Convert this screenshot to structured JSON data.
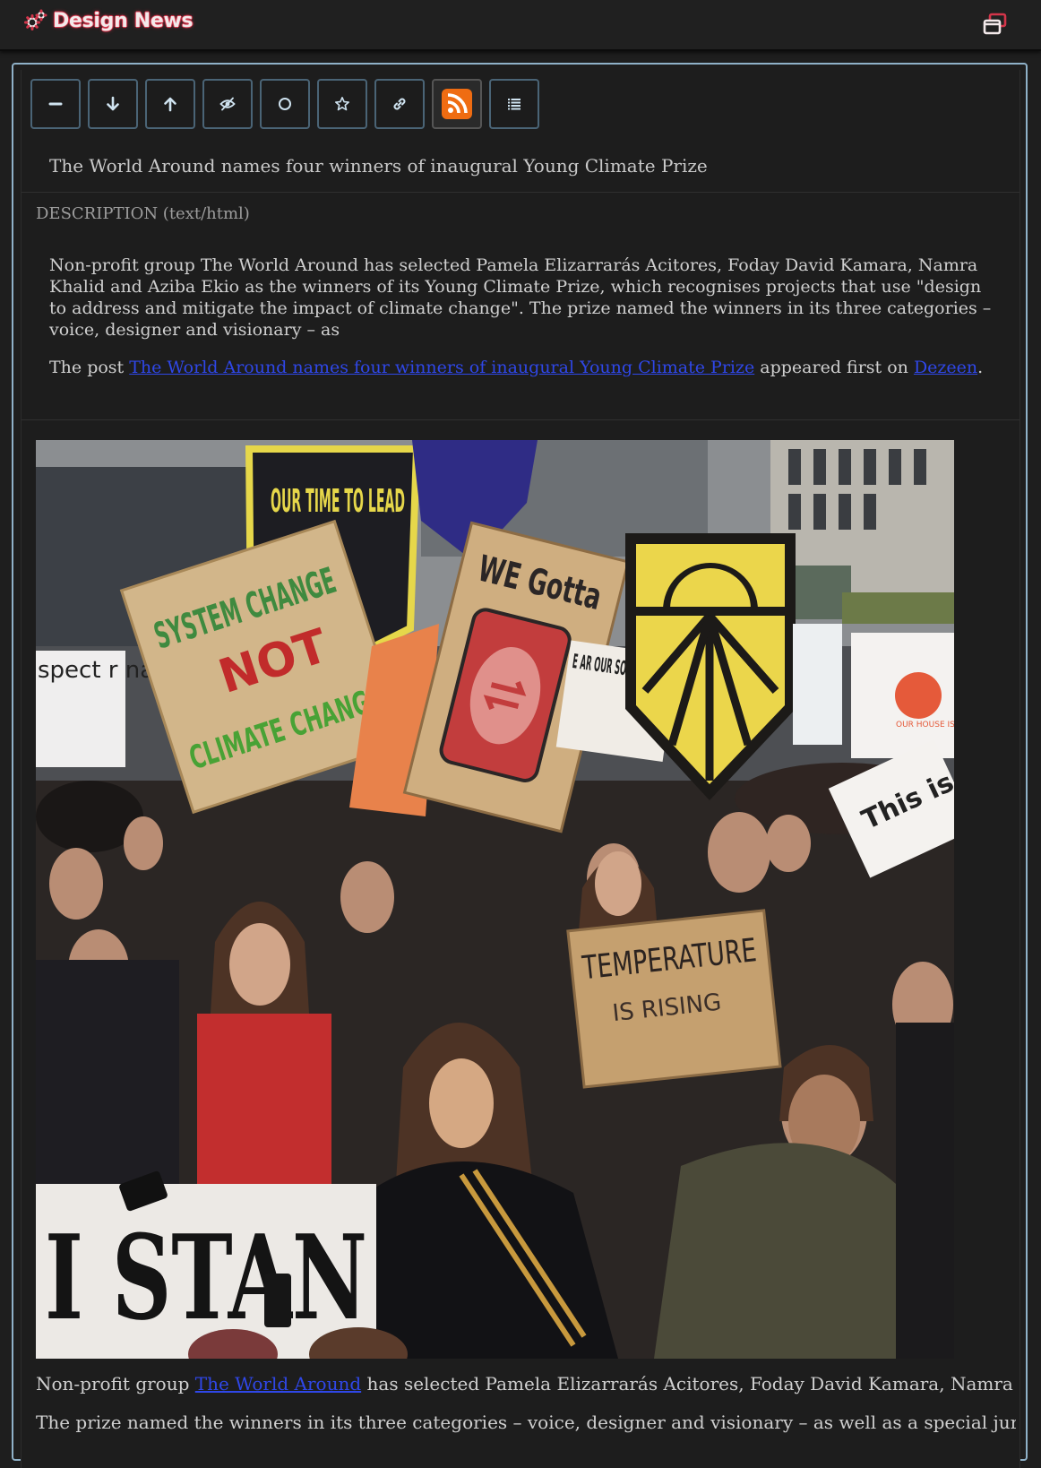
{
  "app": {
    "title": "Design News",
    "brand_icon": "gears-icon",
    "brand_color": "#d3354a",
    "window_icon": "restore-window-icon"
  },
  "toolbar": {
    "buttons": [
      {
        "name": "collapse",
        "icon": "minus-icon"
      },
      {
        "name": "next",
        "icon": "arrow-down-icon"
      },
      {
        "name": "previous",
        "icon": "arrow-up-icon"
      },
      {
        "name": "mark-unread",
        "icon": "eye-slash-icon"
      },
      {
        "name": "mark-read",
        "icon": "circle-icon"
      },
      {
        "name": "favorite",
        "icon": "star-icon"
      },
      {
        "name": "open-link",
        "icon": "link-icon"
      },
      {
        "name": "feed",
        "icon": "rss-icon"
      },
      {
        "name": "list",
        "icon": "list-icon"
      }
    ],
    "accent": "#4a6476",
    "rss_color": "#ef6c12"
  },
  "article": {
    "title": "The World Around names four winners of inaugural Young Climate Prize",
    "description_label": "DESCRIPTION (text/html)",
    "description": "Non-profit group The World Around has selected Pamela Elizarrarás Acitores, Foday David Kamara, Namra Khalid and Aziba Ekio as the winners of its Young Climate Prize, which recognises projects that use \"design to address and mitigate the impact of climate change\". The prize named the winners in its three categories – voice, designer and visionary – as",
    "post_prefix": "The post ",
    "post_link": "The World Around names four winners of inaugural Young Climate Prize",
    "post_middle": " appeared first on ",
    "post_site": "Dezeen",
    "post_suffix": ".",
    "body_line1_prefix": "Non-profit group ",
    "body_line1_link": "The World Around",
    "body_line1_rest": " has selected Pamela Elizarrarás Acitores, Foday David Kamara, Namra Khalid and Aziba Ekio",
    "body_line2": "The prize named the winners in its three categories – voice, designer and visionary – as well as a special jury award."
  },
  "photo": {
    "sign_system_change": "SYSTEM CHANGE",
    "sign_not": "NOT",
    "sign_climate_change": "CLIMATE CHANGE",
    "sign_our_time": "OUR TIME TO LEAD",
    "sign_we_gotta": "WE Gotta",
    "sign_temperature": "TEMPERATURE",
    "sign_is_rising": "IS RISING",
    "sign_i_stand": "I STAN",
    "sign_this_is": "This is",
    "sign_respect": "spect r nature's epers",
    "sign_teach": "E AR OUR SO TEACH YO",
    "sign_our_house": "OUR HOUSE IS ON FIRE"
  }
}
